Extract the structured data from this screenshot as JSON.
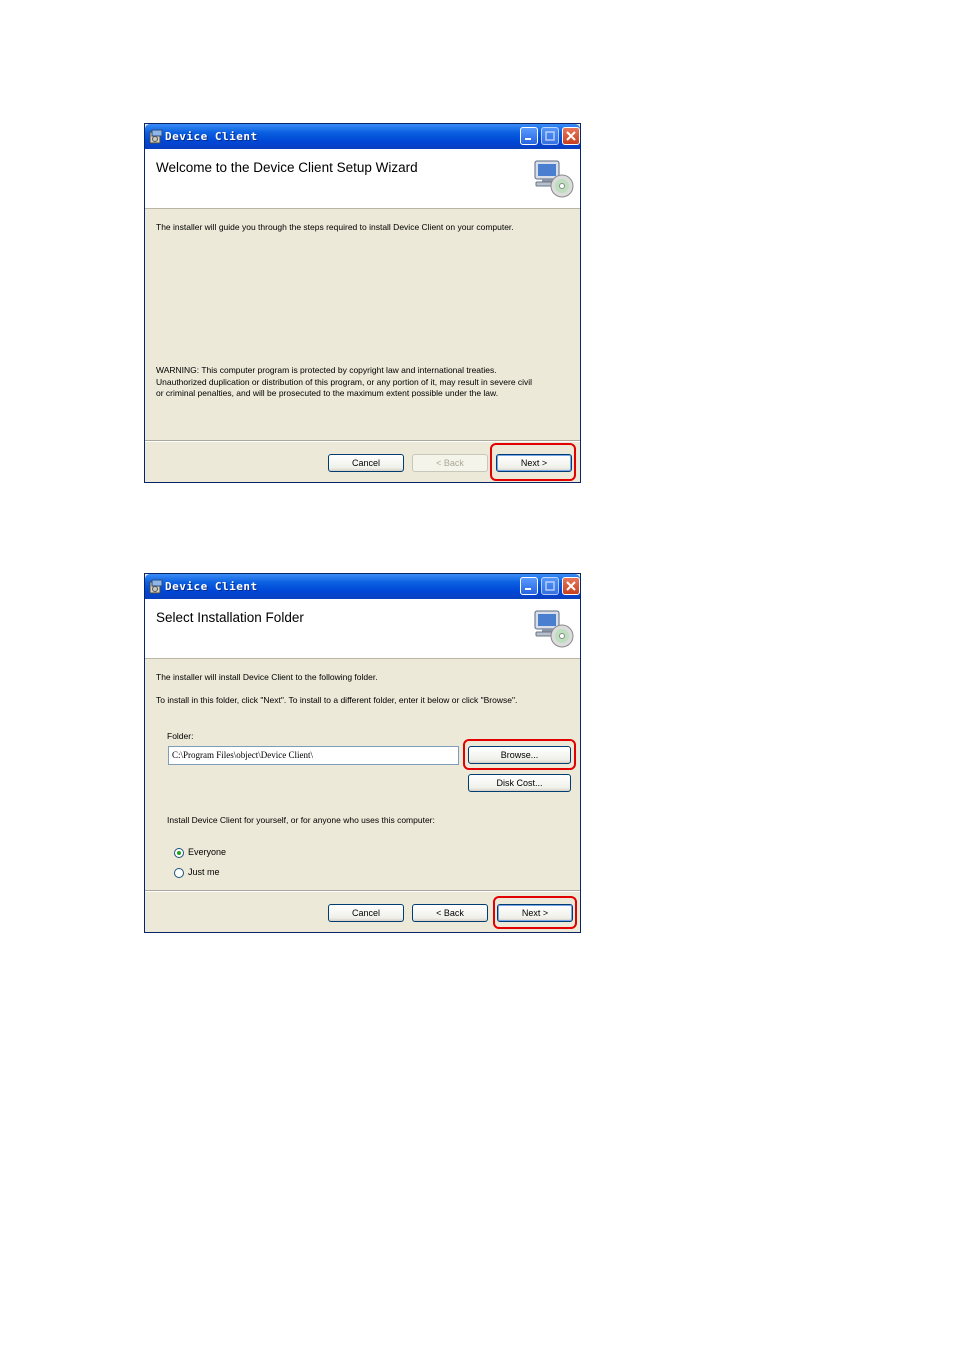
{
  "window1": {
    "title": "Device Client",
    "header_title": "Welcome to the Device Client Setup Wizard",
    "intro": "The installer will guide you through the steps required to install Device Client on your computer.",
    "warning_line1": "WARNING: This computer program is protected by copyright law and international treaties.",
    "warning_line2": "Unauthorized duplication or distribution of this program, or any portion of it, may result in severe civil",
    "warning_line3": "or criminal penalties, and will be prosecuted to the maximum extent possible under the law.",
    "cancel_label": "Cancel",
    "back_label": "< Back",
    "next_label": "Next >",
    "back_enabled": false
  },
  "window2": {
    "title": "Device Client",
    "header_title": "Select Installation Folder",
    "line1": "The installer will install Device Client to the following folder.",
    "line2": "To install in this folder, click \"Next\". To install to a different folder, enter it below or click \"Browse\".",
    "folder_label": "Folder:",
    "folder_value": "C:\\Program Files\\object\\Device Client\\",
    "browse_label": "Browse...",
    "disk_cost_label": "Disk Cost...",
    "install_for_label": "Install Device Client for yourself, or for anyone who uses this computer:",
    "radio_everyone": "Everyone",
    "radio_justme": "Just me",
    "selected_option": "Everyone",
    "cancel_label": "Cancel",
    "back_label": "< Back",
    "next_label": "Next >"
  },
  "colors": {
    "highlight": "#e30000",
    "titlebar": "#0a5fe0",
    "dialog_bg": "#ece9d8"
  },
  "icons": [
    "installer-app-icon",
    "computer-cd-icon",
    "minimize-icon",
    "maximize-icon",
    "close-icon"
  ]
}
